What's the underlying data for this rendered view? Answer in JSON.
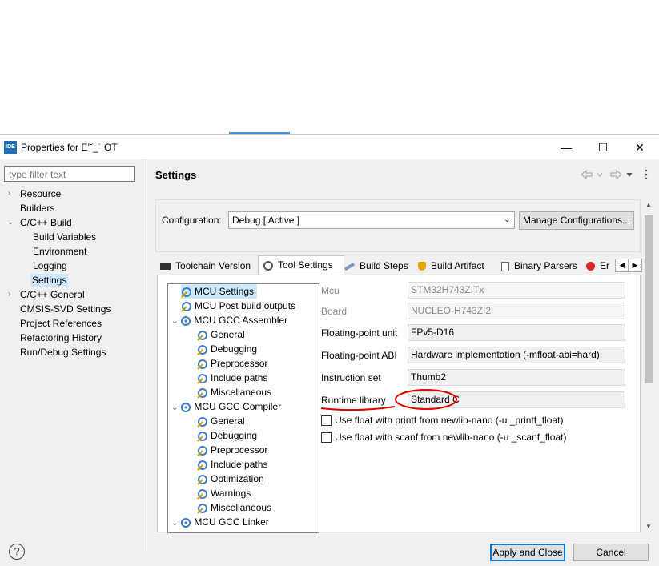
{
  "window": {
    "title": "Properties for E’˘_˙ OT",
    "min": "—",
    "max": "☐",
    "close": "✕",
    "ide_badge": "IDE"
  },
  "filter": {
    "placeholder": "type filter text"
  },
  "sidebar": {
    "items": [
      {
        "label": "Resource"
      },
      {
        "label": "Builders"
      },
      {
        "label": "C/C++ Build"
      },
      {
        "label": "Build Variables"
      },
      {
        "label": "Environment"
      },
      {
        "label": "Logging"
      },
      {
        "label": "Settings"
      },
      {
        "label": "C/C++ General"
      },
      {
        "label": "CMSIS-SVD Settings"
      },
      {
        "label": "Project References"
      },
      {
        "label": "Refactoring History"
      },
      {
        "label": "Run/Debug Settings"
      }
    ]
  },
  "page": {
    "title": "Settings"
  },
  "config": {
    "label": "Configuration:",
    "value": "Debug  [ Active ]",
    "manage": "Manage Configurations..."
  },
  "tabs": [
    {
      "label": "Toolchain Version"
    },
    {
      "label": "Tool Settings"
    },
    {
      "label": "Build Steps"
    },
    {
      "label": "Build Artifact"
    },
    {
      "label": "Binary Parsers"
    },
    {
      "label": "Er"
    }
  ],
  "tree": [
    {
      "label": "MCU Settings"
    },
    {
      "label": "MCU Post build outputs"
    },
    {
      "label": "MCU GCC Assembler"
    },
    {
      "label": "General"
    },
    {
      "label": "Debugging"
    },
    {
      "label": "Preprocessor"
    },
    {
      "label": "Include paths"
    },
    {
      "label": "Miscellaneous"
    },
    {
      "label": "MCU GCC Compiler"
    },
    {
      "label": "General"
    },
    {
      "label": "Debugging"
    },
    {
      "label": "Preprocessor"
    },
    {
      "label": "Include paths"
    },
    {
      "label": "Optimization"
    },
    {
      "label": "Warnings"
    },
    {
      "label": "Miscellaneous"
    },
    {
      "label": "MCU GCC Linker"
    }
  ],
  "fields": {
    "mcu": {
      "label": "Mcu",
      "value": "STM32H743ZITx"
    },
    "board": {
      "label": "Board",
      "value": "NUCLEO-H743ZI2"
    },
    "fpu": {
      "label": "Floating-point unit",
      "value": "FPv5-D16"
    },
    "fabi": {
      "label": "Floating-point ABI",
      "value": "Hardware implementation (-mfloat-abi=hard)"
    },
    "iset": {
      "label": "Instruction set",
      "value": "Thumb2"
    },
    "rtlib": {
      "label": "Runtime library",
      "value": "Standard C"
    }
  },
  "checks": {
    "printf": "Use float with printf from newlib-nano (-u _printf_float)",
    "scanf": "Use float with scanf from newlib-nano (-u _scanf_float)"
  },
  "footer": {
    "help": "?",
    "apply_close": "Apply and Close",
    "cancel": "Cancel"
  },
  "colors": {
    "accent": "#0078d7",
    "selection": "#cce8ff",
    "annotation": "#e00000"
  }
}
